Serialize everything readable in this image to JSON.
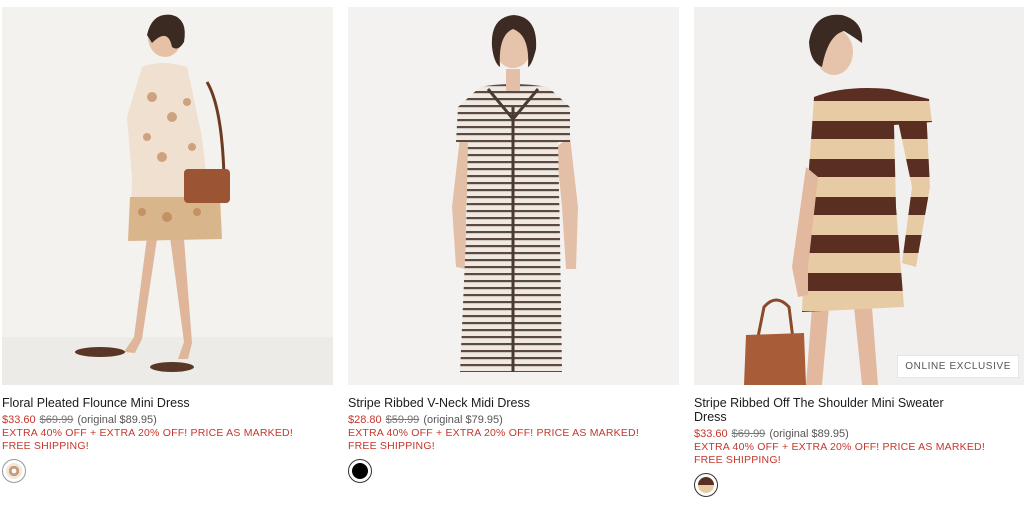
{
  "products": [
    {
      "name": "Floral Pleated Flounce Mini Dress",
      "sale_price": "$33.60",
      "was_price": "$69.99",
      "original": "(original $89.95)",
      "promo": "EXTRA 40% OFF + EXTRA 20% OFF! PRICE AS MARKED!",
      "shipping": "FREE SHIPPING!",
      "swatch_color": "#b9896a",
      "badge": ""
    },
    {
      "name": "Stripe Ribbed V-Neck Midi Dress",
      "sale_price": "$28.80",
      "was_price": "$59.99",
      "original": "(original $79.95)",
      "promo": "EXTRA 40% OFF + EXTRA 20% OFF! PRICE AS MARKED!",
      "shipping": "FREE SHIPPING!",
      "swatch_color": "#000000",
      "badge": ""
    },
    {
      "name": "Stripe Ribbed Off The Shoulder Mini Sweater Dress",
      "sale_price": "$33.60",
      "was_price": "$69.99",
      "original": "(original $89.95)",
      "promo": "EXTRA 40% OFF + EXTRA 20% OFF! PRICE AS MARKED!",
      "shipping": "FREE SHIPPING!",
      "swatch_color": "#5a2f22",
      "badge": "ONLINE EXCLUSIVE"
    }
  ],
  "colors": {
    "sale_red": "#c5372c",
    "text_dark": "#1b1b1b"
  }
}
